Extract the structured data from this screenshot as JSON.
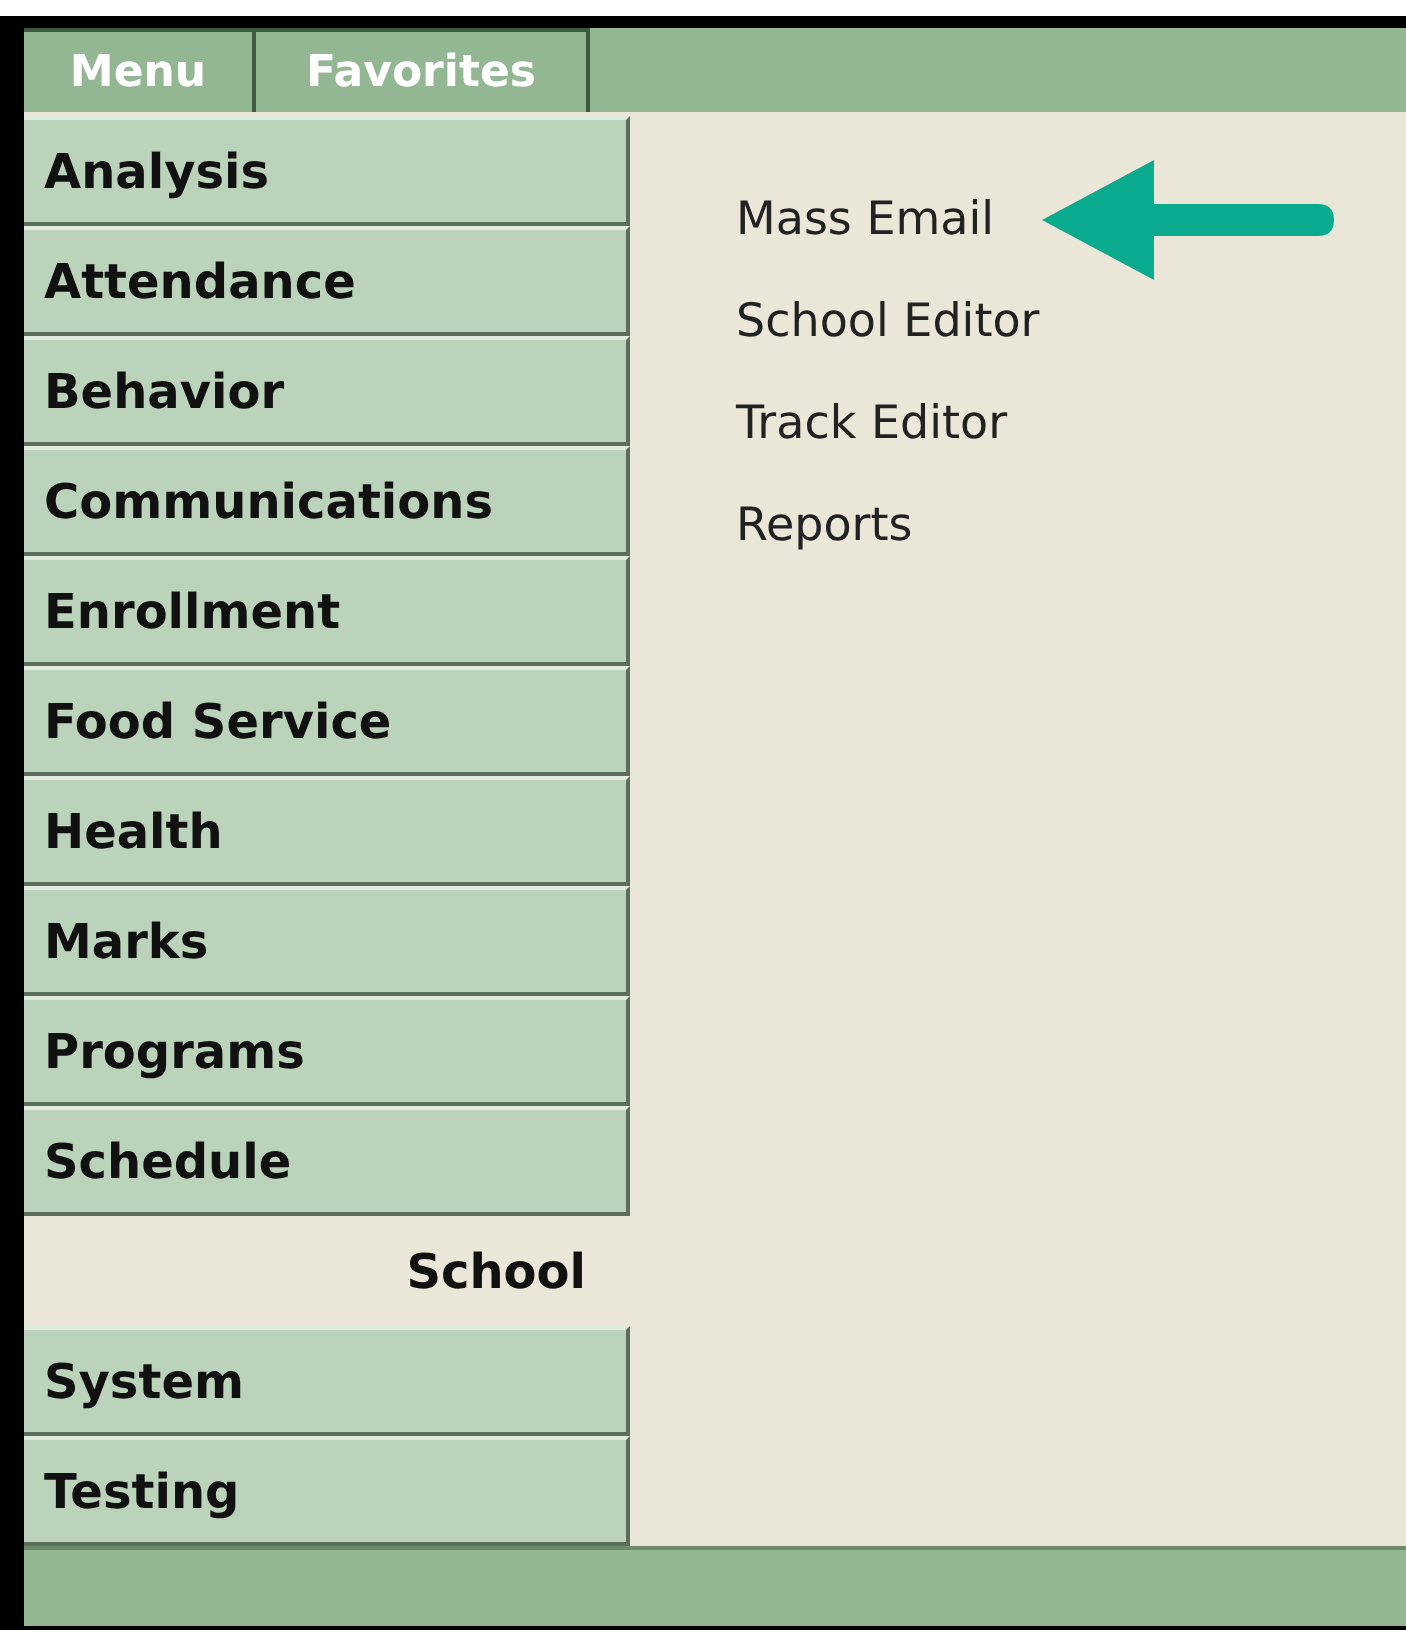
{
  "tabs": [
    {
      "label": "Menu"
    },
    {
      "label": "Favorites"
    }
  ],
  "sidebar": {
    "items": [
      {
        "label": "Analysis",
        "selected": false
      },
      {
        "label": "Attendance",
        "selected": false
      },
      {
        "label": "Behavior",
        "selected": false
      },
      {
        "label": "Communications",
        "selected": false
      },
      {
        "label": "Enrollment",
        "selected": false
      },
      {
        "label": "Food Service",
        "selected": false
      },
      {
        "label": "Health",
        "selected": false
      },
      {
        "label": "Marks",
        "selected": false
      },
      {
        "label": "Programs",
        "selected": false
      },
      {
        "label": "Schedule",
        "selected": false
      },
      {
        "label": "School",
        "selected": true
      },
      {
        "label": "System",
        "selected": false
      },
      {
        "label": "Testing",
        "selected": false
      }
    ]
  },
  "content": {
    "links": [
      {
        "label": "Mass Email",
        "pointed": true
      },
      {
        "label": "School Editor",
        "pointed": false
      },
      {
        "label": "Track Editor",
        "pointed": false
      },
      {
        "label": "Reports",
        "pointed": false
      }
    ]
  }
}
